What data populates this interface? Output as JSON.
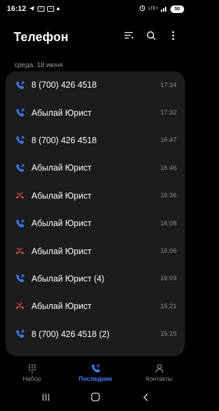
{
  "status_bar": {
    "time": "16:12",
    "network": "LTE+",
    "battery": "50"
  },
  "header": {
    "title": "Телефон"
  },
  "date_group": "среда, 18 июня",
  "calls": [
    {
      "name": "8 (700) 426 4518",
      "time": "17:34",
      "type": "outgoing"
    },
    {
      "name": "Абылай Юрист",
      "time": "17:32",
      "type": "outgoing"
    },
    {
      "name": "8 (700) 426 4518",
      "time": "16:47",
      "type": "outgoing"
    },
    {
      "name": "Абылай Юрист",
      "time": "16:46",
      "type": "outgoing"
    },
    {
      "name": "Абылай Юрист",
      "time": "16:36",
      "type": "missed"
    },
    {
      "name": "Абылай Юрист",
      "time": "16:08",
      "type": "outgoing"
    },
    {
      "name": "Абылай Юрист",
      "time": "16:06",
      "type": "missed"
    },
    {
      "name": "Абылай Юрист (4)",
      "time": "16:03",
      "type": "outgoing"
    },
    {
      "name": "Абылай Юрист",
      "time": "15:21",
      "type": "missed"
    },
    {
      "name": "8 (700) 426 4518 (2)",
      "time": "15:15",
      "type": "outgoing"
    }
  ],
  "bottom_nav": [
    {
      "label": "Набор",
      "icon": "dialpad-icon",
      "active": false
    },
    {
      "label": "Последние",
      "icon": "recents-icon",
      "active": true
    },
    {
      "label": "Контакты",
      "icon": "contacts-icon",
      "active": false
    }
  ],
  "colors": {
    "outgoing": "#3e7cf6",
    "missed": "#e5534b",
    "accent": "#3e7cf6",
    "card": "#1c1c1e"
  }
}
